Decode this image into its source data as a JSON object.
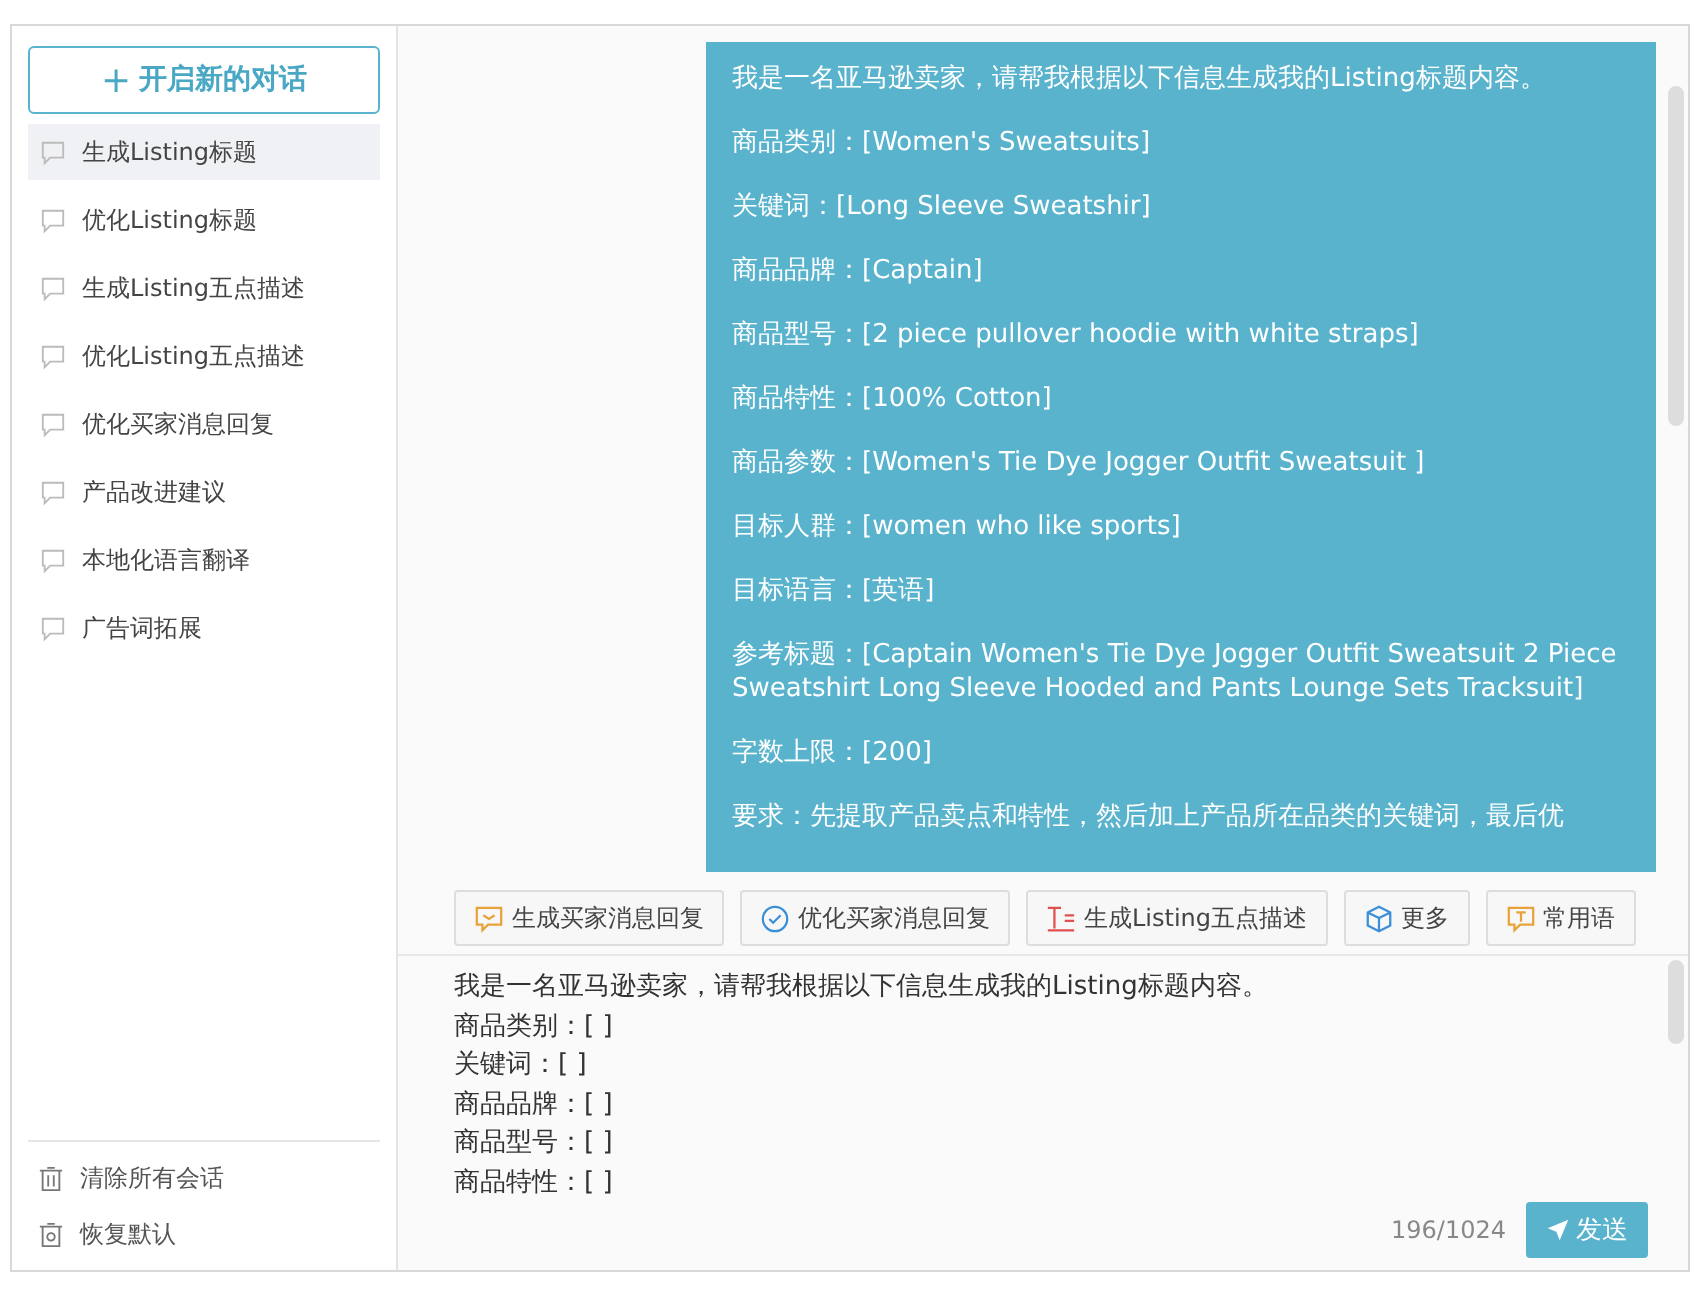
{
  "sidebar": {
    "new_chat_button": {
      "icon": "+",
      "label": "开启新的对话"
    },
    "items": [
      {
        "label": "生成Listing标题",
        "selected": true
      },
      {
        "label": "优化Listing标题",
        "selected": false
      },
      {
        "label": "生成Listing五点描述",
        "selected": false
      },
      {
        "label": "优化Listing五点描述",
        "selected": false
      },
      {
        "label": "优化买家消息回复",
        "selected": false
      },
      {
        "label": "产品改进建议",
        "selected": false
      },
      {
        "label": "本地化语言翻译",
        "selected": false
      },
      {
        "label": "广告词拓展",
        "selected": false
      }
    ],
    "footer": [
      {
        "kind": "clear",
        "label": "清除所有会话"
      },
      {
        "kind": "reset",
        "label": "恢复默认"
      }
    ]
  },
  "message": {
    "paragraphs": [
      "我是一名亚马逊卖家，请帮我根据以下信息生成我的Listing标题内容。",
      "商品类别：[Women's Sweatsuits]",
      "关键词：[Long Sleeve Sweatshir]",
      "商品品牌：[Captain]",
      "商品型号：[2 piece pullover hoodie with white straps]",
      "商品特性：[100% Cotton]",
      "商品参数：[Women's Tie Dye Jogger Outfit Sweatsuit ]",
      "目标人群：[women who like sports]",
      "目标语言：[英语]",
      "参考标题：[Captain Women's Tie Dye Jogger Outfit Sweatsuit 2 Piece Sweatshirt Long Sleeve Hooded and Pants Lounge Sets Tracksuit]",
      "字数上限：[200]",
      "要求：先提取产品卖点和特性，然后加上产品所在品类的关键词，最后优"
    ]
  },
  "toolbar": [
    {
      "kind": "reply",
      "label": "生成买家消息回复"
    },
    {
      "kind": "check",
      "label": "优化买家消息回复"
    },
    {
      "kind": "bullets",
      "label": "生成Listing五点描述"
    },
    {
      "kind": "more",
      "label": "更多"
    },
    {
      "kind": "phrases",
      "label": "常用语"
    }
  ],
  "input": {
    "lines": [
      "我是一名亚马逊卖家，请帮我根据以下信息生成我的Listing标题内容。",
      "商品类别：[ ]",
      "关键词：[ ]",
      "商品品牌：[ ]",
      "商品型号：[ ]",
      "商品特性：[ ]"
    ],
    "counter": "196/1024",
    "send_button": "发送"
  }
}
